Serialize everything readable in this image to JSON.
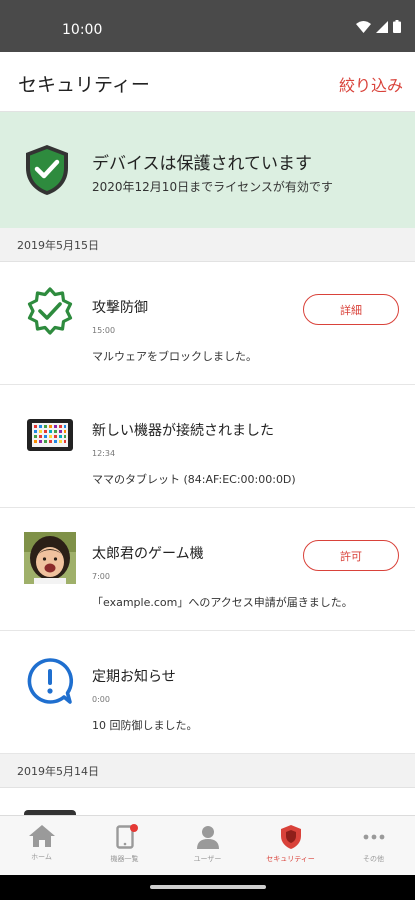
{
  "status_bar": {
    "time": "10:00"
  },
  "header": {
    "title": "セキュリティー",
    "filter_label": "絞り込み"
  },
  "protection": {
    "title": "デバイスは保護されています",
    "subtitle": "2020年12月10日までライセンスが有効です"
  },
  "sections": [
    {
      "date": "2019年5月15日",
      "items": [
        {
          "icon": "badge-check-icon",
          "title": "攻撃防御",
          "time": "15:00",
          "description": "マルウェアをブロックしました。",
          "button": "詳細"
        },
        {
          "icon": "tablet-icon",
          "title": "新しい機器が接続されました",
          "time": "12:34",
          "description": "ママのタブレット (84:AF:EC:00:00:0D)",
          "button": ""
        },
        {
          "icon": "child-avatar",
          "title": "太郎君のゲーム機",
          "time": "7:00",
          "description": "「example.com」へのアクセス申請が届きました。",
          "button": "許可"
        },
        {
          "icon": "alert-bubble-icon",
          "title": "定期お知らせ",
          "time": "0:00",
          "description": "10 回防御しました。",
          "button": ""
        }
      ]
    },
    {
      "date": "2019年5月14日",
      "items": []
    }
  ],
  "tabbar": {
    "items": [
      {
        "label": "ホーム",
        "icon": "home-icon"
      },
      {
        "label": "機器一覧",
        "icon": "device-list-icon"
      },
      {
        "label": "ユーザー",
        "icon": "user-icon"
      },
      {
        "label": "セキュリティー",
        "icon": "security-shield-icon"
      },
      {
        "label": "その他",
        "icon": "more-icon"
      }
    ],
    "active": "セキュリティー"
  },
  "colors": {
    "accent": "#d9423a",
    "protected_bg": "#dcefe1",
    "shield_green": "#2e8b3e",
    "info_blue": "#1f6fcf"
  }
}
